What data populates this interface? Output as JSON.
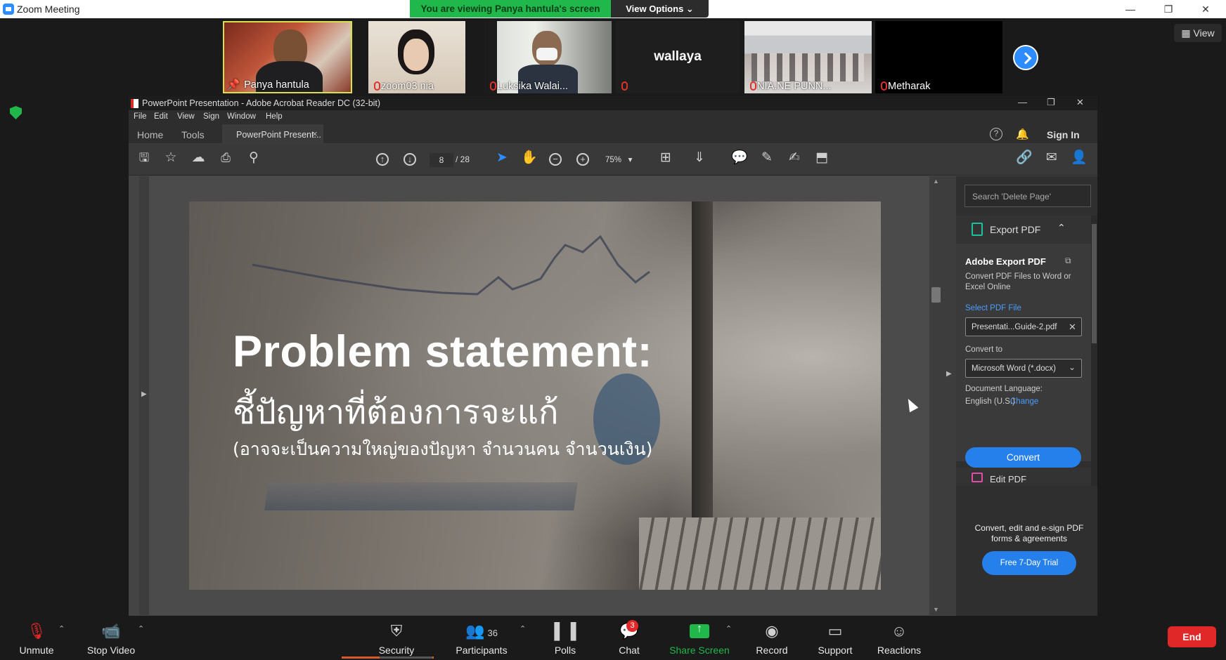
{
  "window": {
    "title": "Zoom Meeting",
    "minimize": "—",
    "restore": "❐",
    "close": "✕"
  },
  "share_banner": {
    "text": "You are viewing Panya hantula's screen",
    "view_options": "View Options ⌄"
  },
  "view_button": "▦ View",
  "participants": [
    {
      "name": "Panya hantula",
      "muted": false
    },
    {
      "name": "zoom03 nia",
      "muted": true
    },
    {
      "name": "Luksika Walai...",
      "muted": true
    },
    {
      "name": "wallaya",
      "muted": true
    },
    {
      "name": "NIA.NE PUNN...",
      "muted": true
    },
    {
      "name": "Metharak",
      "muted": true
    }
  ],
  "acrobat": {
    "title": "PowerPoint Presentation - Adobe Acrobat Reader DC (32-bit)",
    "menu": [
      "File",
      "Edit",
      "View",
      "Sign",
      "Window",
      "Help"
    ],
    "tabs": {
      "home": "Home",
      "tools": "Tools",
      "doc": "PowerPoint Present...",
      "doc_close": "×"
    },
    "right_header": {
      "help": "?",
      "sign_in": "Sign In"
    },
    "page_current": "8",
    "page_total": "/ 28",
    "zoom": "75%",
    "slide": {
      "title": "Problem statement:",
      "sub1": "ชี้ปัญหาที่ต้องการจะแก้",
      "sub2": "(อาจจะเป็นความใหญ่ของปัญหา จำนวนคน จำนวนเงิน)"
    },
    "right_pane": {
      "search_placeholder": "Search 'Delete Page'",
      "export_header": "Export PDF",
      "panel_title": "Adobe Export PDF",
      "panel_desc": "Convert PDF Files to Word or Excel Online",
      "select_label": "Select PDF File",
      "file_name": "Presentati...Guide-2.pdf",
      "convert_to_label": "Convert to",
      "convert_to_value": "Microsoft Word (*.docx)",
      "doc_lang_label": "Document Language:",
      "doc_lang_value": "English (U.S.)",
      "change_link": "Change",
      "convert_button": "Convert",
      "edit_pdf": "Edit PDF",
      "promo": "Convert, edit and e-sign PDF forms & agreements",
      "trial_button": "Free 7-Day Trial"
    }
  },
  "toolbar": {
    "unmute": "Unmute",
    "stop_video": "Stop Video",
    "security": "Security",
    "participants": "Participants",
    "participants_count": "36",
    "polls": "Polls",
    "chat": "Chat",
    "chat_badge": "3",
    "share_screen": "Share Screen",
    "record": "Record",
    "support": "Support",
    "reactions": "Reactions",
    "end": "End"
  },
  "colors": {
    "accent": "#2d8cff",
    "share_green": "#20b84a",
    "end_red": "#e02828",
    "acrobat_blue": "#2680eb"
  }
}
